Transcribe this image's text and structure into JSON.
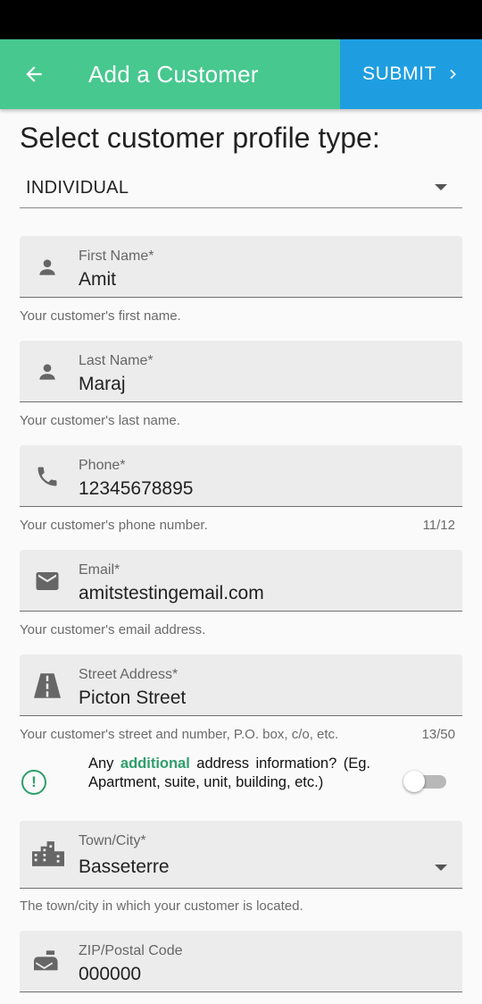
{
  "app_bar": {
    "title": "Add a Customer",
    "submit_label": "SUBMIT",
    "accent_color": "#47c88f",
    "submit_color": "#1e9ee0"
  },
  "profile": {
    "heading": "Select customer profile type:",
    "selected": "INDIVIDUAL"
  },
  "fields": {
    "first_name": {
      "label": "First Name*",
      "value": "Amit",
      "helper": "Your customer's first name.",
      "icon": "person-icon"
    },
    "last_name": {
      "label": "Last Name*",
      "value": "Maraj",
      "helper": "Your customer's last name.",
      "icon": "person-icon"
    },
    "phone": {
      "label": "Phone*",
      "value": "12345678895",
      "helper": "Your customer's phone number.",
      "counter": "11/12",
      "icon": "phone-icon"
    },
    "email": {
      "label": "Email*",
      "value": "amitstestingemail.com",
      "helper": "Your customer's email address.",
      "icon": "mail-icon"
    },
    "street": {
      "label": "Street Address*",
      "value": "Picton Street",
      "helper": "Your customer's street and number, P.O. box, c/o, etc.",
      "counter": "13/50",
      "icon": "road-icon"
    },
    "town": {
      "label": "Town/City*",
      "value": "Basseterre",
      "helper": "The town/city in which your customer is located.",
      "icon": "city-icon"
    },
    "zip": {
      "label": "ZIP/Postal Code",
      "value": "000000",
      "icon": "mailbox-icon"
    }
  },
  "additional": {
    "prefix": "Any ",
    "highlight": "additional",
    "suffix": " address information? (Eg. Apartment, suite, unit, building, etc.)",
    "toggle_on": false,
    "highlight_color": "#2e9e6b"
  }
}
